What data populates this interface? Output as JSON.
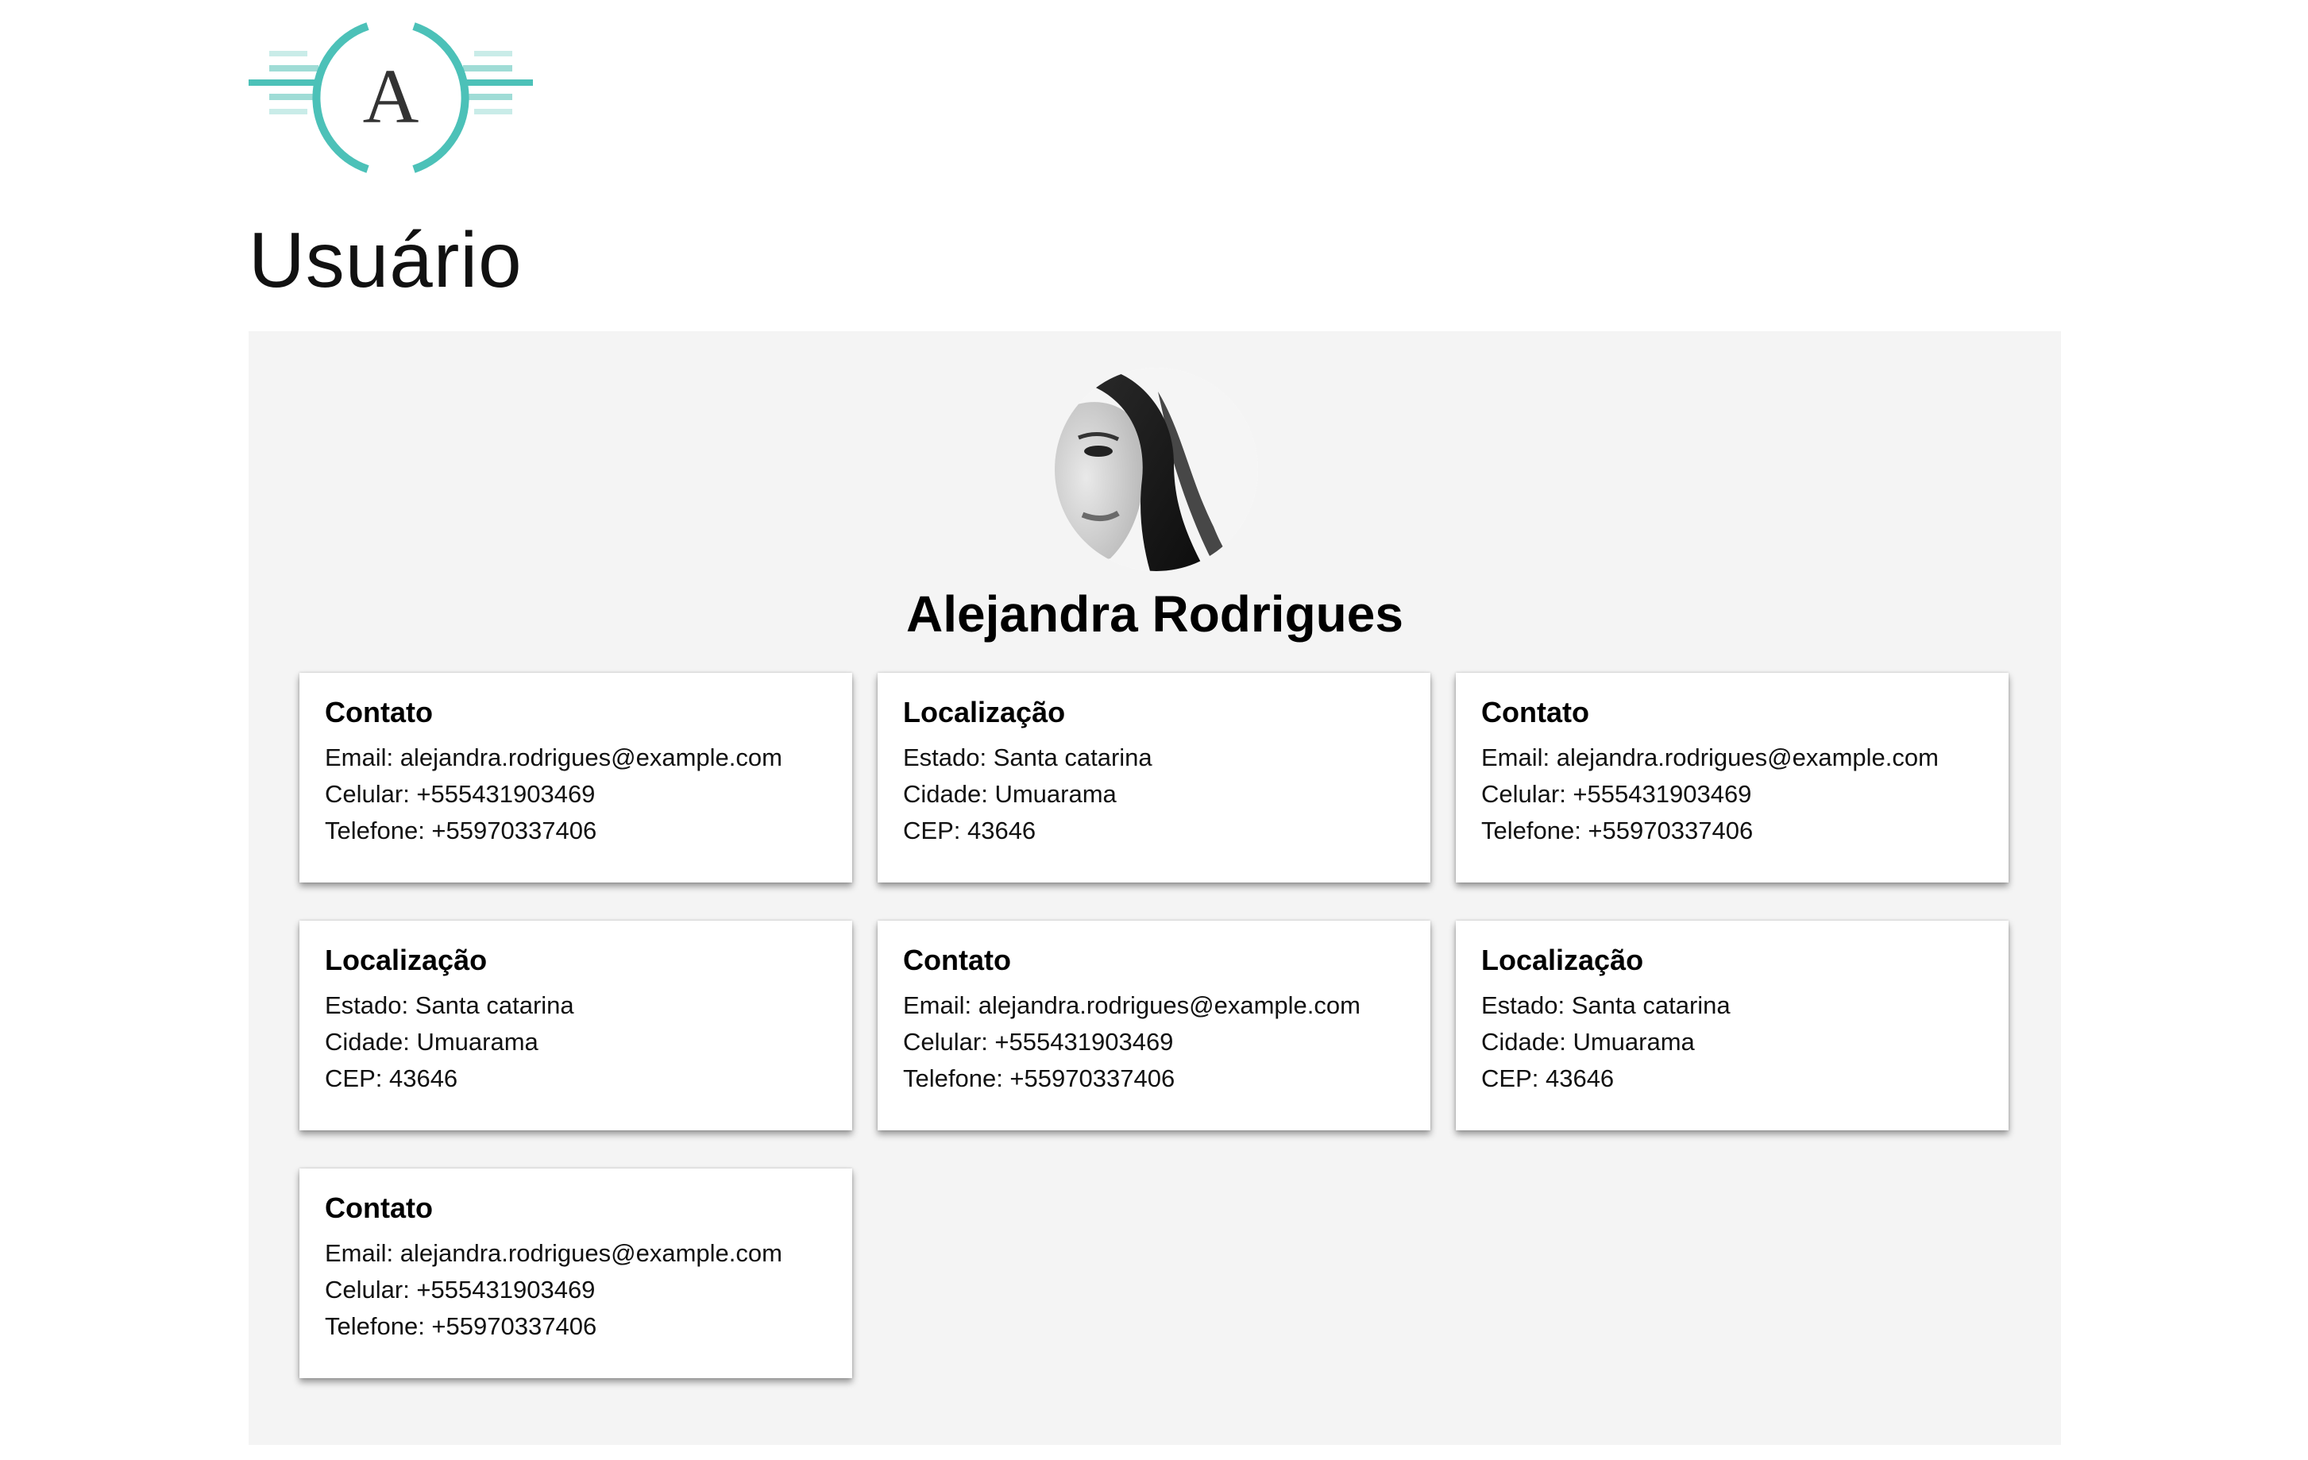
{
  "logo": {
    "letter": "A",
    "accent": "#4cc1b8",
    "accent_light": "#9fdcd6",
    "icon": "brand-logo"
  },
  "page_title": "Usuário",
  "profile": {
    "name": "Alejandra Rodrigues",
    "avatar_icon": "user-avatar"
  },
  "cards": [
    {
      "title": "Contato",
      "lines": [
        "Email: alejandra.rodrigues@example.com",
        "Celular: +555431903469",
        "Telefone: +55970337406"
      ]
    },
    {
      "title": "Localização",
      "lines": [
        "Estado: Santa catarina",
        "Cidade: Umuarama",
        "CEP: 43646"
      ]
    },
    {
      "title": "Contato",
      "lines": [
        "Email: alejandra.rodrigues@example.com",
        "Celular: +555431903469",
        "Telefone: +55970337406"
      ]
    },
    {
      "title": "Localização",
      "lines": [
        "Estado: Santa catarina",
        "Cidade: Umuarama",
        "CEP: 43646"
      ]
    },
    {
      "title": "Contato",
      "lines": [
        "Email: alejandra.rodrigues@example.com",
        "Celular: +555431903469",
        "Telefone: +55970337406"
      ]
    },
    {
      "title": "Localização",
      "lines": [
        "Estado: Santa catarina",
        "Cidade: Umuarama",
        "CEP: 43646"
      ]
    },
    {
      "title": "Contato",
      "lines": [
        "Email: alejandra.rodrigues@example.com",
        "Celular: +555431903469",
        "Telefone: +55970337406"
      ]
    }
  ],
  "colors": {
    "panel_bg": "#f4f4f4",
    "card_bg": "#ffffff"
  }
}
